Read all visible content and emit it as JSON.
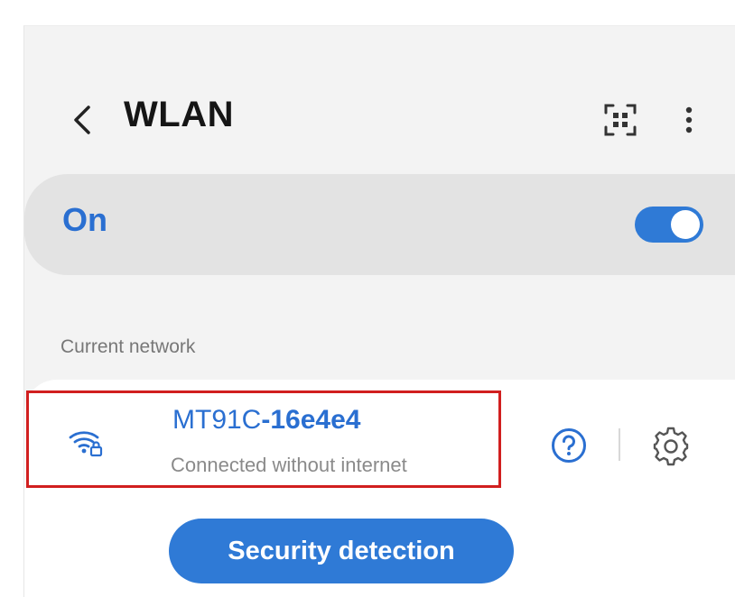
{
  "header": {
    "title": "WLAN",
    "back_icon": "chevron-left-icon",
    "scan_icon": "qr-scan-icon",
    "more_icon": "more-vert-icon"
  },
  "wlan_toggle": {
    "label": "On",
    "state": true
  },
  "current_network": {
    "section_label": "Current network",
    "ssid_prefix": "MT91C",
    "ssid_suffix": "-16e4e4",
    "status": "Connected without internet",
    "wifi_icon": "wifi-lock-icon",
    "help_icon": "question-icon",
    "settings_icon": "gear-icon"
  },
  "actions": {
    "security_detection_label": "Security detection"
  },
  "colors": {
    "accent": "#2f7ad6",
    "highlight": "#d11f1f",
    "background": "#f3f3f3"
  }
}
